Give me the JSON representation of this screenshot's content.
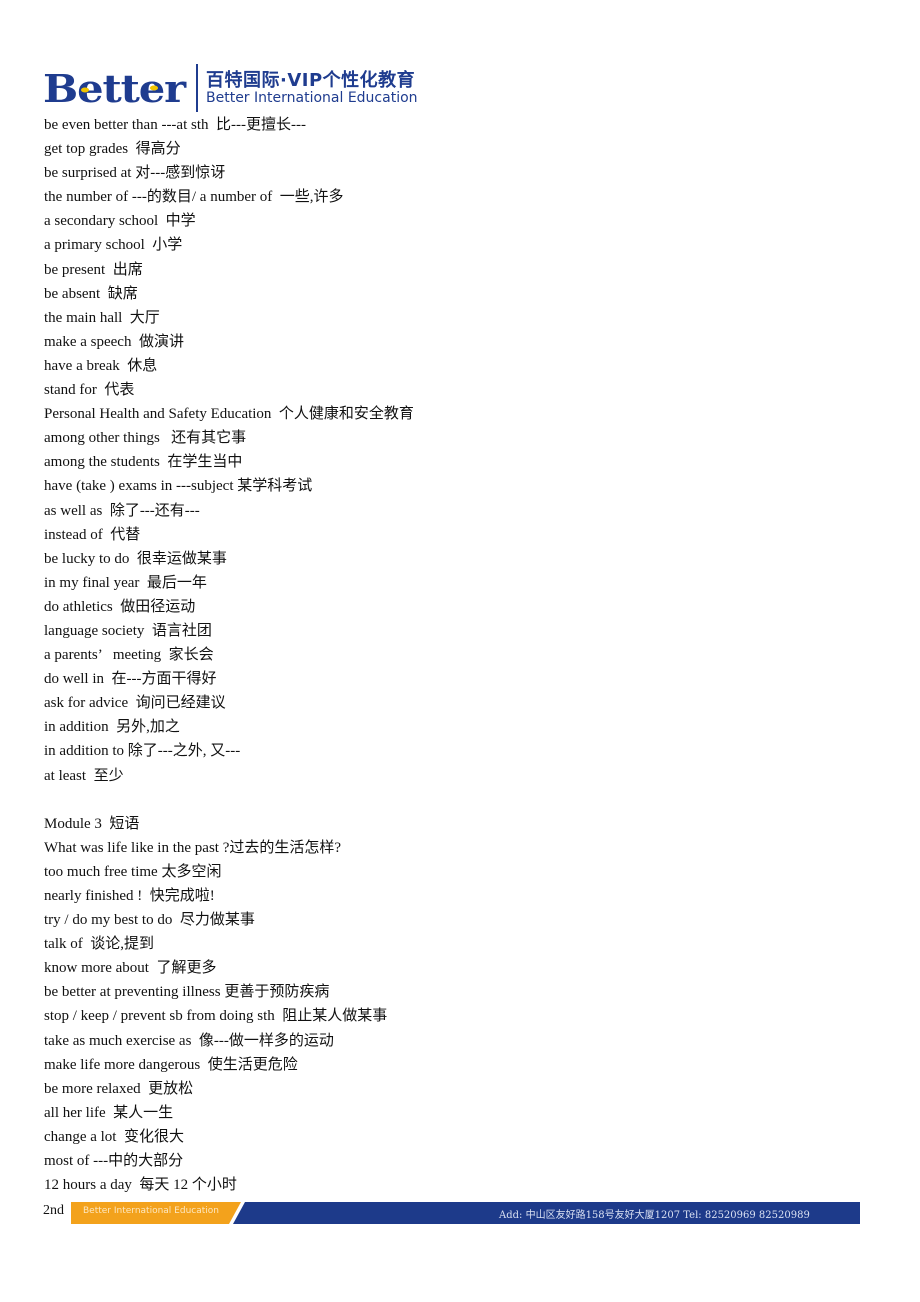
{
  "header": {
    "logo_text": "Better",
    "brand_cn": "百特国际·VIP个性化教育",
    "brand_en": "Better International Education",
    "colors": {
      "brand_blue": "#1f3c8f",
      "accent_yellow": "#f2c500"
    }
  },
  "lines": [
    "be even better than ---at sth  比---更擅长---",
    "get top grades  得高分",
    "be surprised at 对---感到惊讶",
    "the number of ---的数目/ a number of  一些,许多",
    "a secondary school  中学",
    "a primary school  小学",
    "be present  出席",
    "be absent  缺席",
    "the main hall  大厅",
    "make a speech  做演讲",
    "have a break  休息",
    "stand for  代表",
    "Personal Health and Safety Education  个人健康和安全教育",
    "among other things   还有其它事",
    "among the students  在学生当中",
    "have (take ) exams in ---subject 某学科考试",
    "as well as  除了---还有---",
    "instead of  代替",
    "be lucky to do  很幸运做某事",
    "in my final year  最后一年",
    "do athletics  做田径运动",
    "language society  语言社团",
    "a parents’   meeting  家长会",
    "do well in  在---方面干得好",
    "ask for advice  询问已经建议",
    "in addition  另外,加之",
    "in addition to 除了---之外, 又---",
    "at least  至少"
  ],
  "module3": {
    "heading": "Module 3  短语",
    "lines": [
      "What was life like in the past ?过去的生活怎样?",
      "too much free time 太多空闲",
      "nearly finished !  快完成啦!",
      "try / do my best to do  尽力做某事",
      "talk of  谈论,提到",
      "know more about  了解更多",
      "be better at preventing illness 更善于预防疾病",
      "stop / keep / prevent sb from doing sth  阻止某人做某事",
      "take as much exercise as  像---做一样多的运动",
      "make life more dangerous  使生活更危险",
      "be more relaxed  更放松",
      "all her life  某人一生",
      "change a lot  变化很大",
      "most of ---中的大部分",
      "12 hours a day  每天 12 个小时"
    ]
  },
  "footer": {
    "page_number": "2nd",
    "band_text": "Better International Education",
    "address": "Add: 中山区友好路158号友好大厦1207   Tel: 82520969   82520989",
    "colors": {
      "orange": "#f3a21c",
      "navy": "#1d3a8a"
    }
  }
}
